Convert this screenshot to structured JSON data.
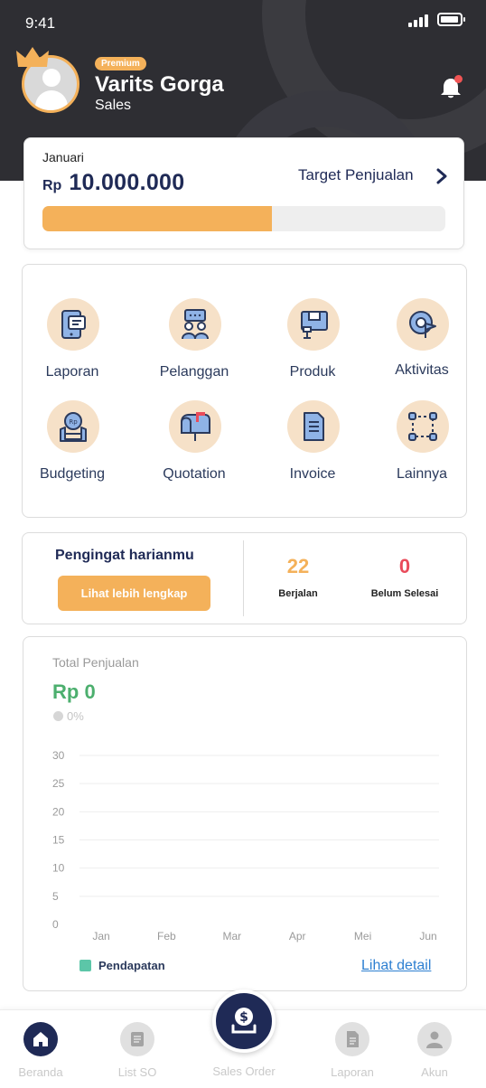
{
  "status_bar": {
    "time": "9:41"
  },
  "profile": {
    "badge": "Premium",
    "name": "Varits Gorga",
    "role": "Sales"
  },
  "target": {
    "month": "Januari",
    "currency": "Rp",
    "amount": "10.000.000",
    "link_label": "Target Penjualan",
    "progress": 0.57
  },
  "menu": [
    {
      "label": "Laporan",
      "icon": "report-icon"
    },
    {
      "label": "Pelanggan",
      "icon": "customers-icon"
    },
    {
      "label": "Produk",
      "icon": "product-icon"
    },
    {
      "label": "Aktivitas",
      "icon": "activity-icon"
    },
    {
      "label": "Budgeting",
      "icon": "budgeting-icon"
    },
    {
      "label": "Quotation",
      "icon": "mailbox-icon"
    },
    {
      "label": "Invoice",
      "icon": "invoice-icon"
    },
    {
      "label": "Lainnya",
      "icon": "more-icon"
    }
  ],
  "reminder": {
    "title": "Pengingat harianmu",
    "button": "Lihat lebih lengkap",
    "stats": [
      {
        "value": "22",
        "label": "Berjalan"
      },
      {
        "value": "0",
        "label": "Belum Selesai"
      }
    ]
  },
  "sales": {
    "title": "Total Penjualan",
    "value": "Rp 0",
    "change": "0%",
    "legend": "Pendapatan",
    "detail_link": "Lihat detail"
  },
  "chart_data": {
    "type": "line",
    "categories": [
      "Jan",
      "Feb",
      "Mar",
      "Apr",
      "Mei",
      "Jun"
    ],
    "series": [
      {
        "name": "Pendapatan",
        "values": [
          0,
          0,
          0,
          0,
          0,
          0
        ],
        "color": "#5cc6a8"
      }
    ],
    "yticks": [
      0,
      5,
      10,
      15,
      20,
      25,
      30
    ],
    "ylim": [
      0,
      30
    ],
    "grid": true,
    "legend": "bottom-left"
  },
  "nav": {
    "items": [
      {
        "label": "Beranda",
        "icon": "home-icon"
      },
      {
        "label": "List SO",
        "icon": "list-icon"
      },
      {
        "label": "Laporan",
        "icon": "document-icon"
      },
      {
        "label": "Akun",
        "icon": "user-icon"
      }
    ],
    "center_label": "Sales Order",
    "center_icon": "money-icon"
  },
  "colors": {
    "accent": "#f4b15a",
    "primary": "#1f2a56",
    "positive": "#4caf6e",
    "danger": "#e94b5a",
    "header": "#2e2e33"
  }
}
